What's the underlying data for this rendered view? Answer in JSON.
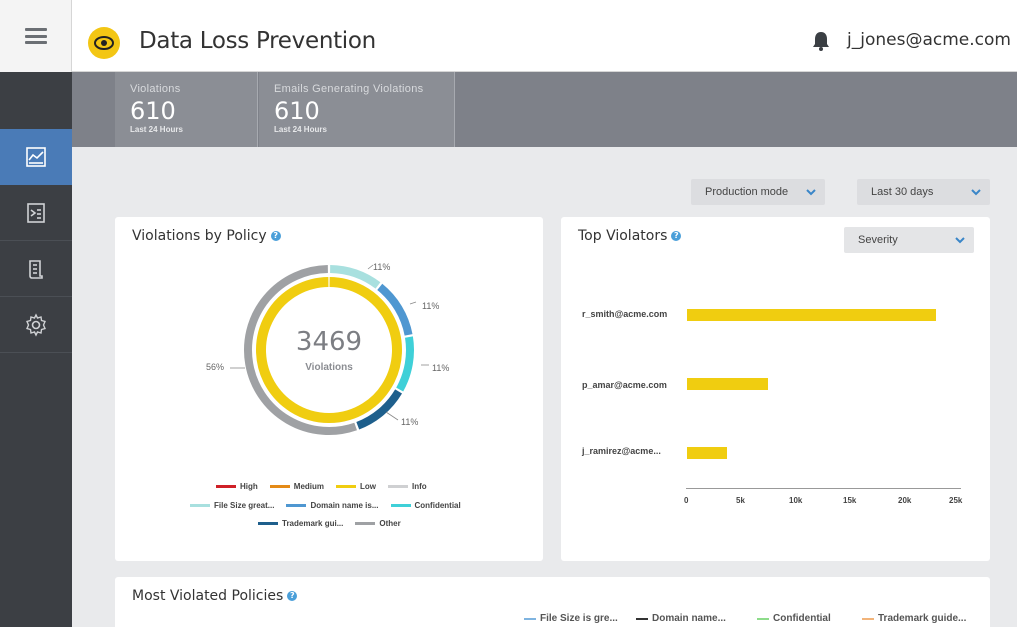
{
  "header": {
    "app_title": "Data Loss Prevention",
    "user_email": "j_jones@acme.com"
  },
  "stats": [
    {
      "label": "Violations",
      "value": "610",
      "period": "Last 24 Hours"
    },
    {
      "label": "Emails Generating Violations",
      "value": "610",
      "period": "Last 24 Hours"
    }
  ],
  "filters": {
    "mode": "Production mode",
    "range": "Last 30 days"
  },
  "violations_by_policy": {
    "title": "Violations by Policy",
    "total": "3469",
    "total_label": "Violations",
    "segments": [
      {
        "name": "File Size great...",
        "pct": "11%",
        "color": "#a8e0df"
      },
      {
        "name": "Domain name is...",
        "pct": "11%",
        "color": "#4f97d1"
      },
      {
        "name": "Confidential",
        "pct": "11%",
        "color": "#3fd0d8"
      },
      {
        "name": "Trademark gui...",
        "pct": "11%",
        "color": "#1e5f8c"
      },
      {
        "name": "Other",
        "pct": "56%",
        "color": "#9fa1a4"
      }
    ],
    "severity_legend": [
      {
        "name": "High",
        "color": "#cf2027"
      },
      {
        "name": "Medium",
        "color": "#e48a17"
      },
      {
        "name": "Low",
        "color": "#f0cd10"
      },
      {
        "name": "Info",
        "color": "#cfd0d2"
      }
    ]
  },
  "top_violators": {
    "title": "Top Violators",
    "sort_by": "Severity",
    "rows": [
      {
        "user": "r_smith@acme.com",
        "value": 23000
      },
      {
        "user": "p_amar@acme.com",
        "value": 7500
      },
      {
        "user": "j_ramirez@acme...",
        "value": 3700
      }
    ],
    "axis_ticks": [
      "0",
      "5k",
      "10k",
      "15k",
      "20k",
      "25k"
    ]
  },
  "most_violated": {
    "title": "Most Violated Policies",
    "legend": [
      {
        "name": "File Size is gre...",
        "color": "#7fb4e0"
      },
      {
        "name": "Domain name...",
        "color": "#333333"
      },
      {
        "name": "Confidential",
        "color": "#8ddc8a"
      },
      {
        "name": "Trademark guide...",
        "color": "#f2b47a"
      }
    ]
  },
  "chart_data": {
    "type": "bar",
    "categories": [
      "r_smith@acme.com",
      "p_amar@acme.com",
      "j_ramirez@acme..."
    ],
    "values": [
      23000,
      7500,
      3700
    ],
    "xlim": [
      0,
      25000
    ],
    "title": "Top Violators"
  }
}
